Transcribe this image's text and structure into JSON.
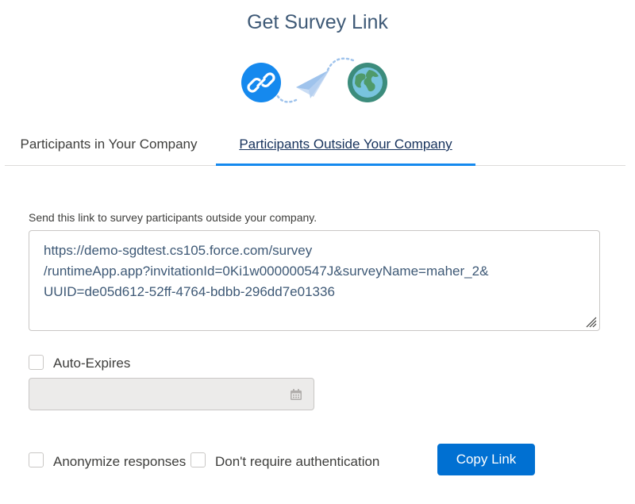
{
  "title": "Get Survey Link",
  "hero": {
    "icons": [
      "link-icon",
      "paper-plane-icon",
      "globe-icon"
    ],
    "colors": {
      "link_bg": "#1589ee",
      "globe_bg": "#3c8c7c",
      "plane": "#9fc3ec"
    }
  },
  "tabs": [
    {
      "label": "Participants in Your Company",
      "active": false
    },
    {
      "label": "Participants Outside Your Company",
      "active": true
    }
  ],
  "instruction": "Send this link to survey participants outside your company.",
  "link": {
    "line1": "https://demo-sgdtest.cs105.force.com/survey",
    "line2": "/runtimeApp.app?invitationId=0Ki1w000000547J&surveyName=maher_2&",
    "line3": "UUID=de05d612-52ff-4764-bdbb-296dd7e01336"
  },
  "auto_expires": {
    "label": "Auto-Expires",
    "checked": false,
    "date_value": ""
  },
  "options": {
    "anonymize": {
      "label": "Anonymize responses",
      "checked": false
    },
    "no_auth": {
      "label": "Don't require authentication",
      "checked": false
    }
  },
  "copy_button": "Copy Link",
  "accent_color": "#0070d2"
}
